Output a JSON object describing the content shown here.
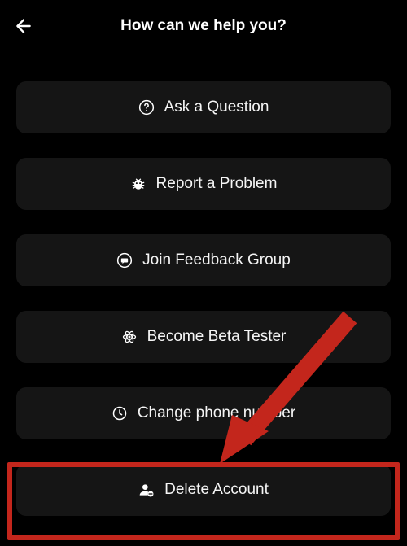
{
  "header": {
    "title": "How can we help you?"
  },
  "options": {
    "ask_question": "Ask a Question",
    "report_problem": "Report a Problem",
    "join_feedback": "Join Feedback Group",
    "beta_tester": "Become Beta Tester",
    "change_phone": "Change phone number",
    "delete_account": "Delete Account"
  },
  "annotation": {
    "highlight_color": "#c3261c"
  }
}
